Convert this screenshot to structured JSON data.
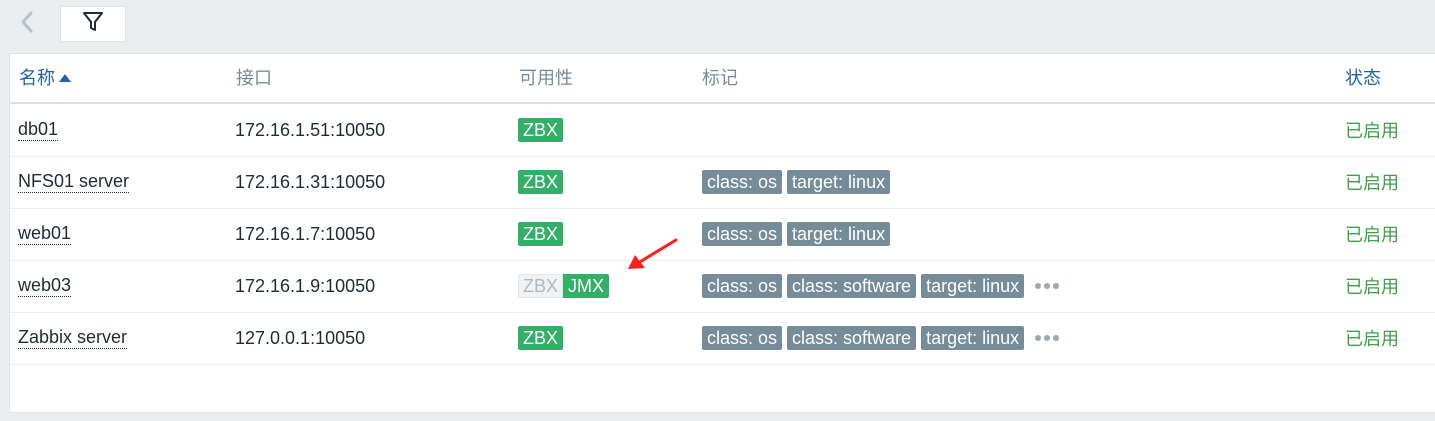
{
  "toolbar": {
    "back_icon": "chevron-left-icon",
    "filter_icon": "filter-icon"
  },
  "table": {
    "headers": {
      "name": "名称",
      "interface": "接口",
      "availability": "可用性",
      "tags": "标记",
      "status": "状态"
    },
    "sort": {
      "column": "name",
      "direction": "asc"
    },
    "rows": [
      {
        "name": "db01",
        "interface": "172.16.1.51:10050",
        "availability": [
          {
            "label": "ZBX",
            "state": "available"
          }
        ],
        "tags": [],
        "more": false,
        "status": "已启用"
      },
      {
        "name": "NFS01 server",
        "interface": "172.16.1.31:10050",
        "availability": [
          {
            "label": "ZBX",
            "state": "available"
          }
        ],
        "tags": [
          "class: os",
          "target: linux"
        ],
        "more": false,
        "status": "已启用"
      },
      {
        "name": "web01",
        "interface": "172.16.1.7:10050",
        "availability": [
          {
            "label": "ZBX",
            "state": "available"
          }
        ],
        "tags": [
          "class: os",
          "target: linux"
        ],
        "more": false,
        "status": "已启用"
      },
      {
        "name": "web03",
        "interface": "172.16.1.9:10050",
        "availability": [
          {
            "label": "ZBX",
            "state": "unknown"
          },
          {
            "label": "JMX",
            "state": "available"
          }
        ],
        "tags": [
          "class: os",
          "class: software",
          "target: linux"
        ],
        "more": true,
        "status": "已启用"
      },
      {
        "name": "Zabbix server",
        "interface": "127.0.0.1:10050",
        "availability": [
          {
            "label": "ZBX",
            "state": "available"
          }
        ],
        "tags": [
          "class: os",
          "class: software",
          "target: linux"
        ],
        "more": true,
        "status": "已启用"
      }
    ]
  },
  "colors": {
    "available": "#34af67",
    "unknown": "#f0f2f3",
    "tag": "#768d99",
    "status_enabled": "#429e47",
    "header_link": "#1f65a6",
    "annotation_arrow": "#ff1e1e"
  }
}
